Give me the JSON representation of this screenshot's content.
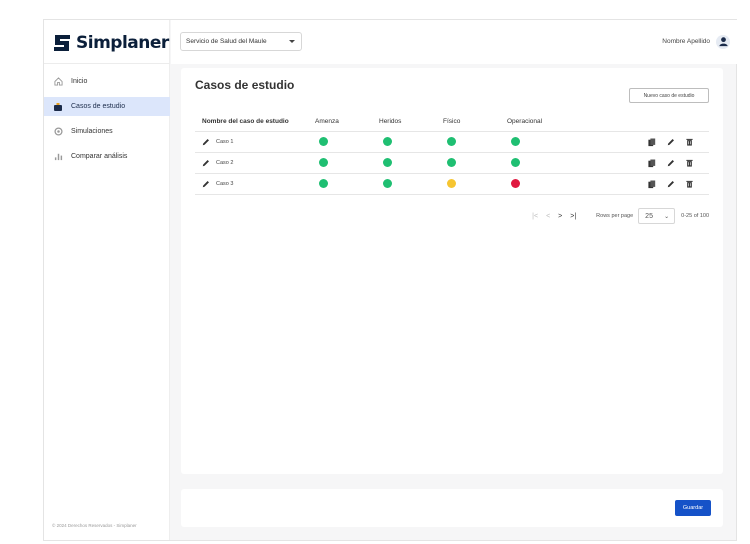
{
  "brand": {
    "name": "Simplaner",
    "color": "#0b1f3a"
  },
  "sidebar": {
    "items": [
      {
        "label": "Inicio",
        "icon": "home-icon",
        "active": false
      },
      {
        "label": "Casos de estudio",
        "icon": "briefcase-icon",
        "active": true
      },
      {
        "label": "Simulaciones",
        "icon": "gear-icon",
        "active": false
      },
      {
        "label": "Comparar análisis",
        "icon": "bar-chart-icon",
        "active": false
      }
    ],
    "footer": "© 2024 Derechos Reservados - Simplaner"
  },
  "topbar": {
    "org_select_value": "Servicio de Salud del Maule",
    "user_name": "Nombre Apellido"
  },
  "main": {
    "title": "Casos de estudio",
    "new_case_label": "Nuevo caso de estudio",
    "columns": [
      "Nombre del caso de estudio",
      "Amenza",
      "Heridos",
      "Físico",
      "Operacional"
    ],
    "rows": [
      {
        "name": "Caso 1",
        "amenaza": "green",
        "heridos": "green",
        "fisico": "green",
        "operacional": "green"
      },
      {
        "name": "Caso 2",
        "amenaza": "green",
        "heridos": "green",
        "fisico": "green",
        "operacional": "green"
      },
      {
        "name": "Caso 3",
        "amenaza": "green",
        "heridos": "green",
        "fisico": "yellow",
        "operacional": "red"
      }
    ],
    "pagination": {
      "rows_per_page_label": "Rows per page",
      "rows_per_page_value": "25",
      "range": "0-25 of 100"
    }
  },
  "footer": {
    "save_label": "Guardar"
  },
  "colors": {
    "green": "#1fbf72",
    "yellow": "#f6c531",
    "red": "#e0183f",
    "accent": "#1552c8",
    "active_nav": "#dce6fb"
  }
}
